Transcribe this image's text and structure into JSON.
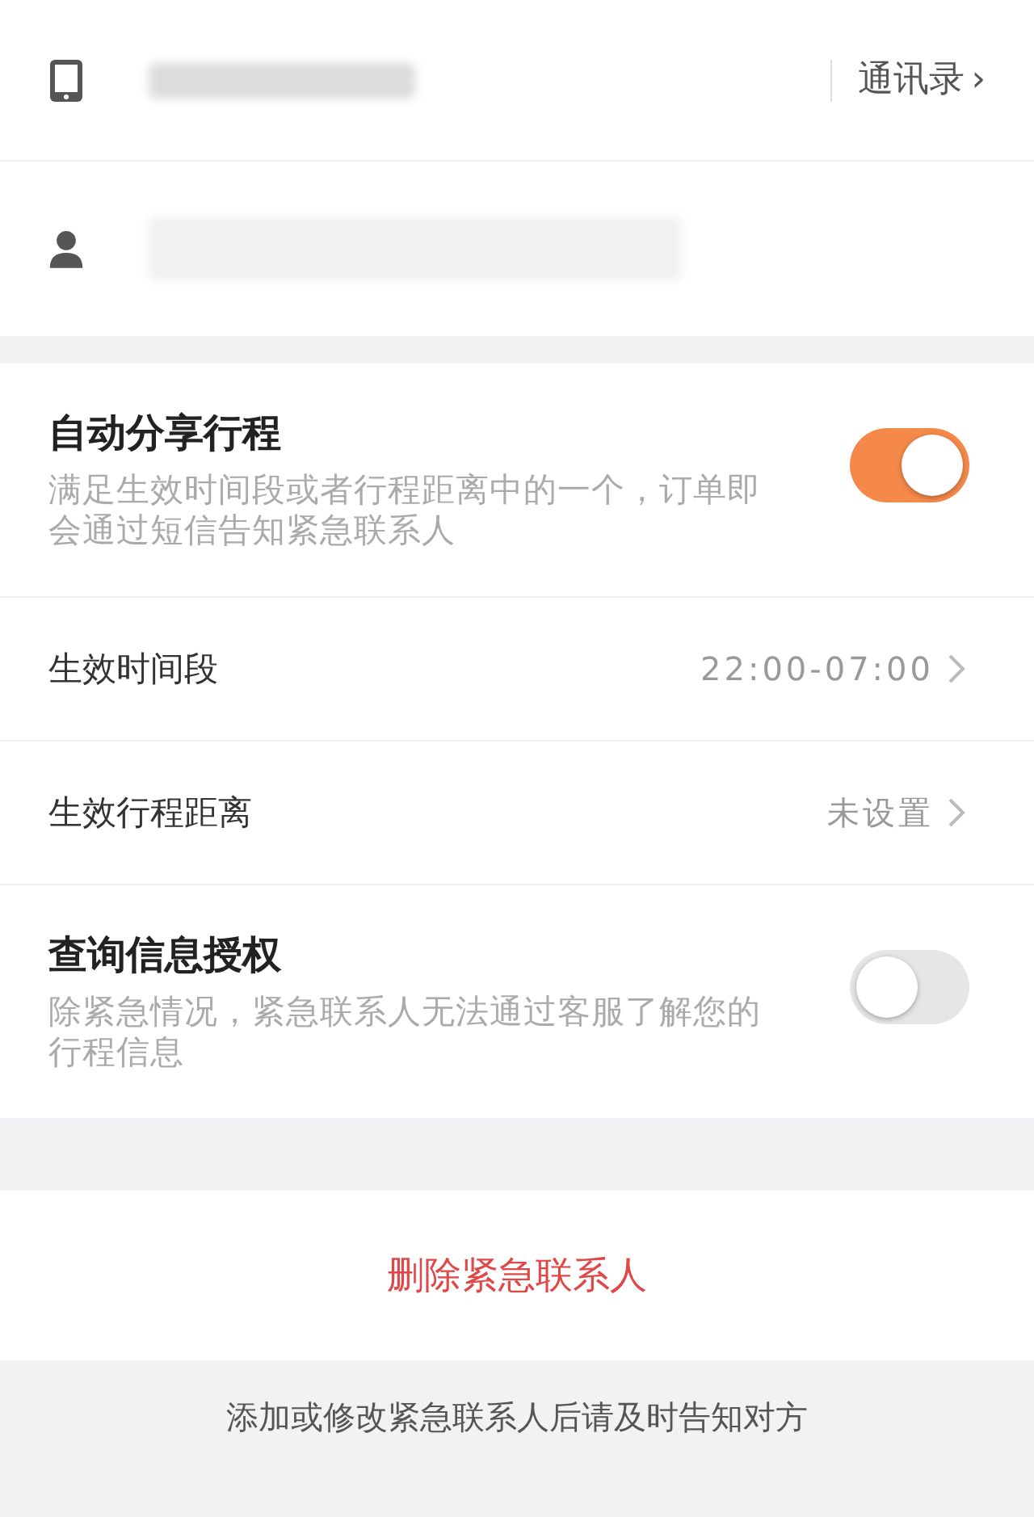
{
  "contact": {
    "phone": {
      "masked": true,
      "link": "通讯录",
      "chevron": "›"
    },
    "name": {
      "masked": true
    }
  },
  "settings": [
    {
      "kind": "toggle",
      "title": "自动分享行程",
      "description": "满足生效时间段或者行程距离中的一个，订单即会通过短信告知紧急联系人",
      "on": true
    },
    {
      "kind": "link",
      "label": "生效时间段",
      "value": "22:00-07:00"
    },
    {
      "kind": "link",
      "label": "生效行程距离",
      "value": "未设置"
    },
    {
      "kind": "toggle",
      "title": "查询信息授权",
      "description": "除紧急情况，紧急联系人无法通过客服了解您的行程信息",
      "on": false
    }
  ],
  "delete_button": "删除紧急联系人",
  "footer_note": "添加或修改紧急联系人后请及时告知对方"
}
